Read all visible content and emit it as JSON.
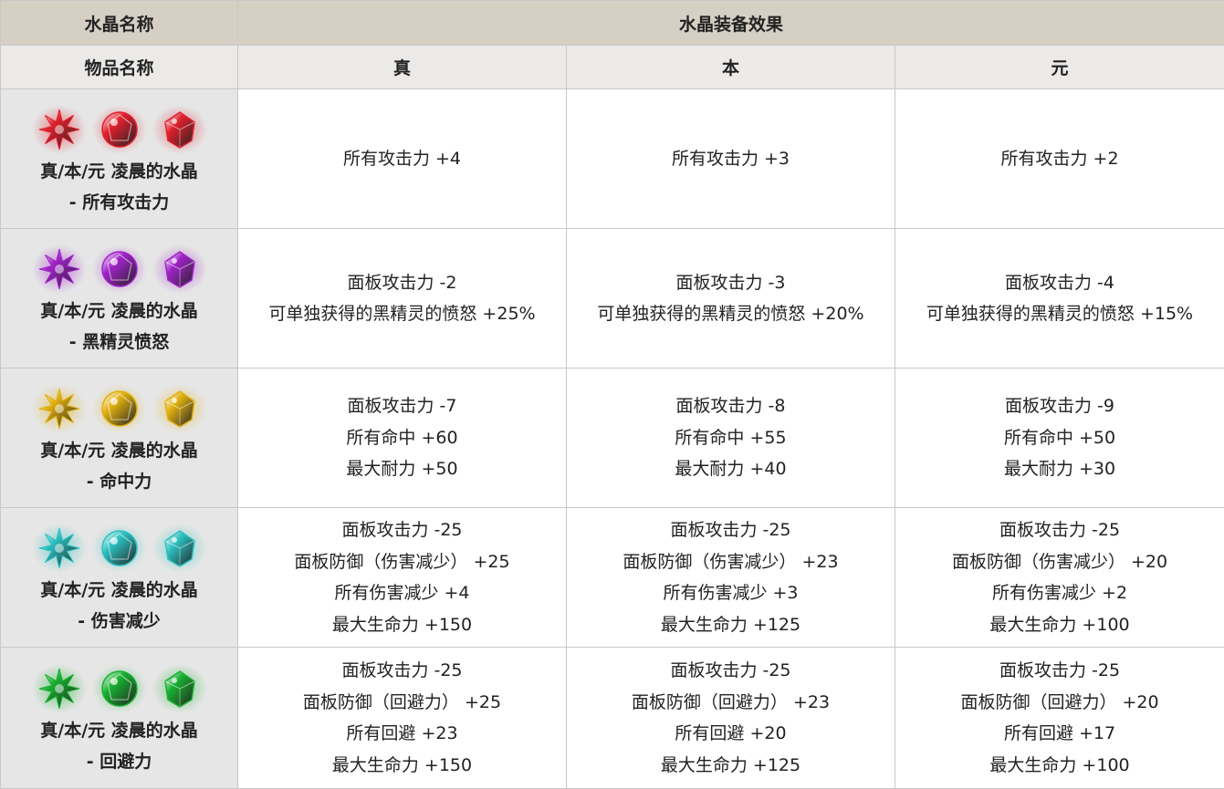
{
  "header": {
    "crystal_name_label": "水晶名称",
    "crystal_effect_label": "水晶装备效果",
    "item_name_label": "物品名称",
    "tiers": [
      "真",
      "本",
      "元"
    ]
  },
  "rows": [
    {
      "gem_color": "#e0202c",
      "gem_icon": "red-crystal-icon",
      "name_line1": "真/本/元 凌晨的水晶",
      "name_line2": "- 所有攻击力",
      "effects": [
        [
          "所有攻击力 +4"
        ],
        [
          "所有攻击力 +3"
        ],
        [
          "所有攻击力 +2"
        ]
      ]
    },
    {
      "gem_color": "#a023c8",
      "gem_icon": "purple-crystal-icon",
      "name_line1": "真/本/元 凌晨的水晶",
      "name_line2": "- 黑精灵愤怒",
      "effects": [
        [
          "面板攻击力 -2",
          "可单独获得的黑精灵的愤怒 +25%"
        ],
        [
          "面板攻击力 -3",
          "可单独获得的黑精灵的愤怒 +20%"
        ],
        [
          "面板攻击力 -4",
          "可单独获得的黑精灵的愤怒 +15%"
        ]
      ]
    },
    {
      "gem_color": "#e0b010",
      "gem_icon": "yellow-crystal-icon",
      "name_line1": "真/本/元 凌晨的水晶",
      "name_line2": "- 命中力",
      "effects": [
        [
          "面板攻击力 -7",
          "所有命中 +60",
          "最大耐力 +50"
        ],
        [
          "面板攻击力 -8",
          "所有命中 +55",
          "最大耐力 +40"
        ],
        [
          "面板攻击力 -9",
          "所有命中 +50",
          "最大耐力 +30"
        ]
      ]
    },
    {
      "gem_color": "#2cc0c0",
      "gem_icon": "cyan-crystal-icon",
      "name_line1": "真/本/元 凌晨的水晶",
      "name_line2": "- 伤害减少",
      "effects": [
        [
          "面板攻击力 -25",
          "面板防御（伤害减少） +25",
          "所有伤害减少 +4",
          "最大生命力 +150"
        ],
        [
          "面板攻击力 -25",
          "面板防御（伤害减少） +23",
          "所有伤害减少 +3",
          "最大生命力 +125"
        ],
        [
          "面板攻击力 -25",
          "面板防御（伤害减少） +20",
          "所有伤害减少 +2",
          "最大生命力 +100"
        ]
      ]
    },
    {
      "gem_color": "#18b030",
      "gem_icon": "green-crystal-icon",
      "name_line1": "真/本/元 凌晨的水晶",
      "name_line2": "- 回避力",
      "effects": [
        [
          "面板攻击力 -25",
          "面板防御（回避力） +25",
          "所有回避 +23",
          "最大生命力 +150"
        ],
        [
          "面板攻击力 -25",
          "面板防御（回避力） +23",
          "所有回避 +20",
          "最大生命力 +125"
        ],
        [
          "面板攻击力 -25",
          "面板防御（回避力） +20",
          "所有回避 +17",
          "最大生命力 +100"
        ]
      ]
    }
  ]
}
